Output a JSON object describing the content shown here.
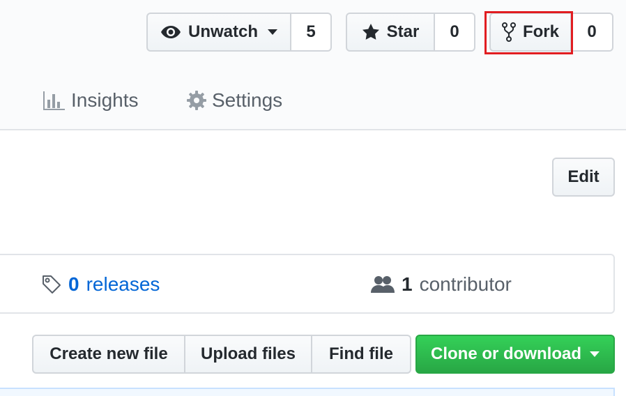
{
  "social": {
    "watch": {
      "label": "Unwatch",
      "count": "5"
    },
    "star": {
      "label": "Star",
      "count": "0"
    },
    "fork": {
      "label": "Fork",
      "count": "0"
    }
  },
  "tabs": [
    {
      "label": "Insights",
      "icon": "graph-icon"
    },
    {
      "label": "Settings",
      "icon": "gear-icon"
    }
  ],
  "edit_label": "Edit",
  "summary": {
    "releases": {
      "count": "0",
      "label": "releases"
    },
    "contributors": {
      "count": "1",
      "label": "contributor"
    }
  },
  "file_actions": [
    "Create new file",
    "Upload files",
    "Find file"
  ],
  "clone_label": "Clone or download",
  "colors": {
    "link": "#0366d6",
    "clone_green": "#28a745",
    "highlight_red": "#e11d21"
  }
}
